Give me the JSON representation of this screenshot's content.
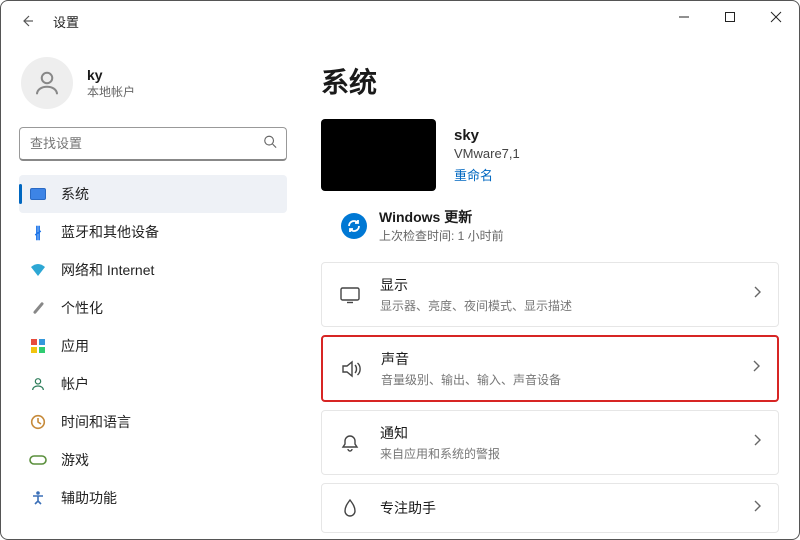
{
  "window": {
    "title": "设置"
  },
  "profile": {
    "name": "ky",
    "sub": "本地帐户"
  },
  "search": {
    "placeholder": "查找设置"
  },
  "nav": {
    "system": "系统",
    "bluetooth": "蓝牙和其他设备",
    "network": "网络和 Internet",
    "personalization": "个性化",
    "apps": "应用",
    "accounts": "帐户",
    "time": "时间和语言",
    "gaming": "游戏",
    "accessibility": "辅助功能"
  },
  "page": {
    "heading": "系统"
  },
  "device": {
    "name": "sky",
    "model": "VMware7,1",
    "rename": "重命名"
  },
  "update": {
    "title": "Windows 更新",
    "sub": "上次检查时间: 1 小时前"
  },
  "cards": {
    "display": {
      "title": "显示",
      "sub": "显示器、亮度、夜间模式、显示描述"
    },
    "sound": {
      "title": "声音",
      "sub": "音量级别、输出、输入、声音设备"
    },
    "notifications": {
      "title": "通知",
      "sub": "来自应用和系统的警报"
    },
    "focus": {
      "title": "专注助手"
    }
  }
}
